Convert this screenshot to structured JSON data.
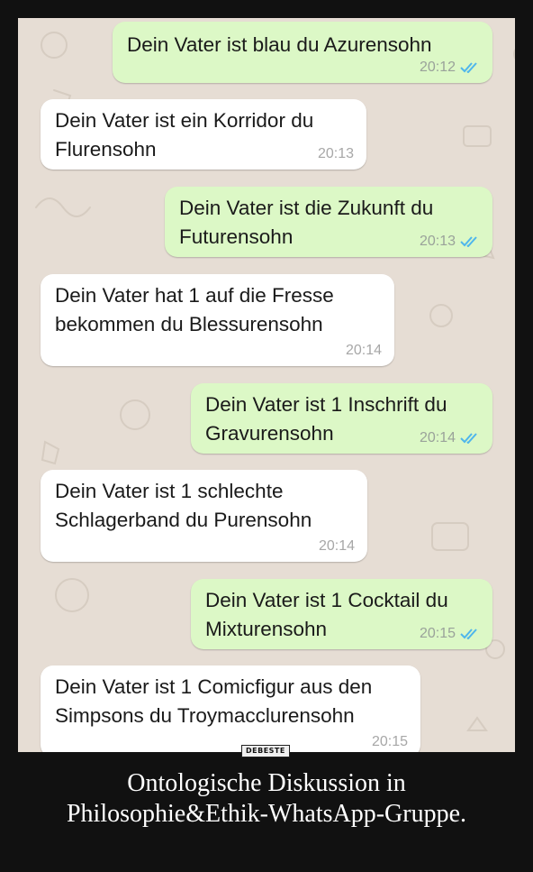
{
  "messages": [
    {
      "side": "out",
      "text": "Dein Vater ist blau du Azurensohn",
      "time": "20:12",
      "read": true
    },
    {
      "side": "in",
      "text": "Dein Vater ist ein Korridor du\nFlurensohn",
      "time": "20:13"
    },
    {
      "side": "out",
      "text": "Dein Vater ist die Zukunft du\nFuturensohn",
      "time": "20:13",
      "read": true
    },
    {
      "side": "in",
      "text": "Dein Vater hat 1 auf die Fresse\nbekommen du Blessurensohn",
      "time": "20:14"
    },
    {
      "side": "out",
      "text": "Dein Vater ist 1 Inschrift du\nGravurensohn",
      "time": "20:14",
      "read": true
    },
    {
      "side": "in",
      "text": "Dein Vater ist 1 schlechte\nSchlagerband du Purensohn",
      "time": "20:14"
    },
    {
      "side": "out",
      "text": "Dein Vater ist 1 Cocktail du\nMixturensohn",
      "time": "20:15",
      "read": true
    },
    {
      "side": "in",
      "text": "Dein Vater ist 1 Comicfigur aus den\nSimpsons du Troymacclurensohn",
      "time": "20:15"
    }
  ],
  "watermark": "DEBESTE",
  "caption": "Ontologische Diskussion in\nPhilosophie&Ethik-WhatsApp-Gruppe.",
  "colors": {
    "outgoing_bubble": "#dcf8c6",
    "incoming_bubble": "#ffffff",
    "chat_background": "#e6ddd4",
    "read_ticks": "#4fb6ec",
    "frame": "#111111"
  },
  "icons": {
    "read_receipt": "double-check-icon"
  }
}
